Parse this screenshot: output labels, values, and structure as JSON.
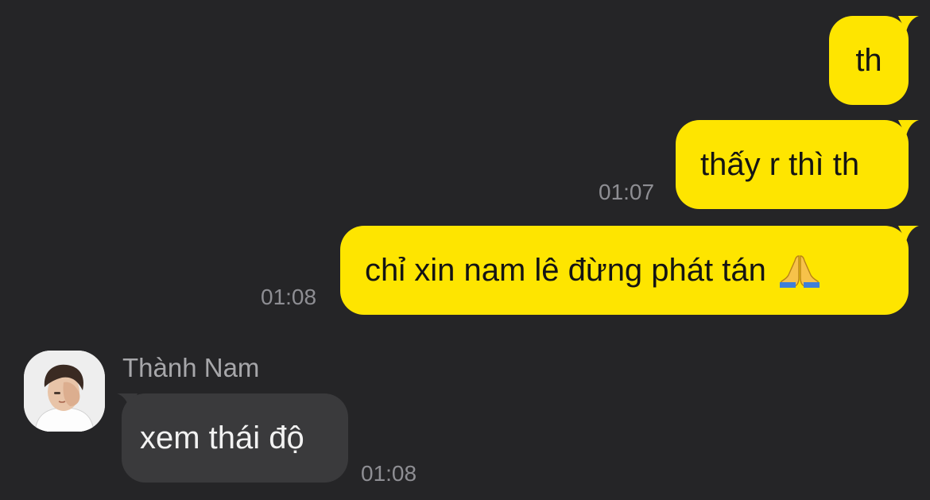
{
  "messages": [
    {
      "side": "outgoing",
      "text": "th",
      "time": ""
    },
    {
      "side": "outgoing",
      "text": "thấy r thì th",
      "time": "01:07"
    },
    {
      "side": "outgoing",
      "text": "chỉ xin nam lê đừng phát tán",
      "emoji": "folded-hands",
      "time": "01:08"
    },
    {
      "side": "incoming",
      "sender": "Thành Nam",
      "text": "xem thái độ",
      "time": "01:08"
    }
  ],
  "colors": {
    "background": "#252527",
    "outgoing_bubble": "#fee500",
    "incoming_bubble": "#3a3a3c",
    "timestamp": "#8e8e93"
  }
}
